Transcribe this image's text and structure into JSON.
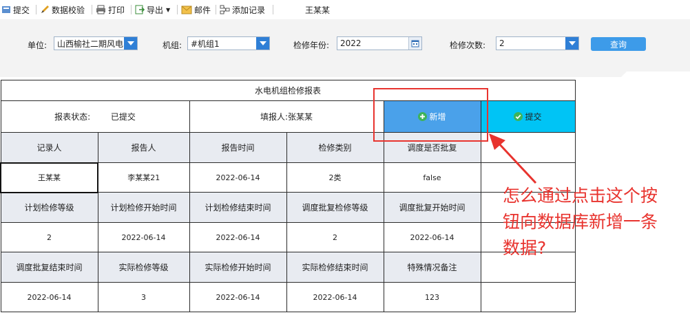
{
  "toolbar": {
    "submit": "提交",
    "validate": "数据校验",
    "print": "打印",
    "export": "导出",
    "email": "邮件",
    "add_record": "添加记录",
    "user": "王某某"
  },
  "filters": {
    "unit_label": "单位:",
    "unit_value": "山西榆社二期风电",
    "unit_label_sep": "",
    "unit_group_label": "机组:",
    "unit_group_value": "#机组1",
    "year_label": "检修年份:",
    "year_value": "2022",
    "count_label": "检修次数:",
    "count_value": "2",
    "query_button": "查询"
  },
  "report": {
    "title": "水电机组检修报表",
    "status_label": "报表状态:",
    "status_value": "已提交",
    "filler": "填报人:张某某",
    "add_button": "新增",
    "submit_button": "提交",
    "headers1": [
      "记录人",
      "报告人",
      "报告时间",
      "检修类别",
      "调度是否批复"
    ],
    "values1": [
      "王某某",
      "李某某21",
      "2022-06-14",
      "2类",
      "false"
    ],
    "headers2": [
      "计划检修等级",
      "计划检修开始时间",
      "计划检修结束时间",
      "调度批复检修等级",
      "调度批复开始时间"
    ],
    "values2": [
      "2",
      "2022-06-14",
      "2022-06-14",
      "2",
      "2022-06-14"
    ],
    "headers3": [
      "调度批复结束时间",
      "实际检修等级",
      "实际检修开始时间",
      "实际检修结束时间",
      "特殊情况备注"
    ],
    "values3": [
      "2022-06-14",
      "3",
      "2022-06-14",
      "2022-06-14",
      "123"
    ]
  },
  "annotation": {
    "text": "怎么通过点击这个按\n钮向数据库新增一条\n数据?",
    "color": "#e8332e"
  },
  "colors": {
    "add_button_bg": "#4aa1ea",
    "submit_button_bg": "#00c4f5",
    "header_bg": "#e8ebf1",
    "query_button_bg": "#3d9be9"
  }
}
